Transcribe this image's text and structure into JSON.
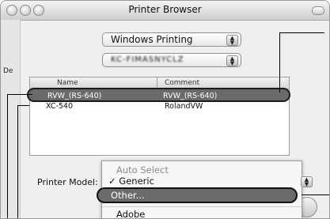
{
  "window": {
    "title": "Printer Browser"
  },
  "toolbar": {
    "partial_label": "De"
  },
  "connection_popup": {
    "selected": "Windows Printing"
  },
  "workgroup_popup": {
    "selected": "KC-FIMASNYCLZ"
  },
  "printer_list": {
    "columns": [
      "Name",
      "Comment"
    ],
    "rows": [
      {
        "name": "RVW_(RS-640)",
        "comment": "RVW_(RS-640)",
        "selected": true
      },
      {
        "name": "XC-540",
        "comment": "RolandVW",
        "selected": false
      }
    ]
  },
  "printer_model": {
    "label": "Printer Model:",
    "menu_items": [
      {
        "label": "Auto Select",
        "state": "disabled"
      },
      {
        "label": "✓ Generic",
        "state": "checked"
      },
      {
        "label": "Other...",
        "state": "highlighted"
      },
      {
        "label": "Adobe",
        "state": "normal"
      }
    ]
  },
  "icons": [
    "close-button",
    "minimize-button",
    "zoom-button",
    "toolbar-pill",
    "popup-arrows-icon"
  ],
  "colors": {
    "selection": "#6a6a6a",
    "window": "#efefef",
    "callout": "#000000"
  }
}
